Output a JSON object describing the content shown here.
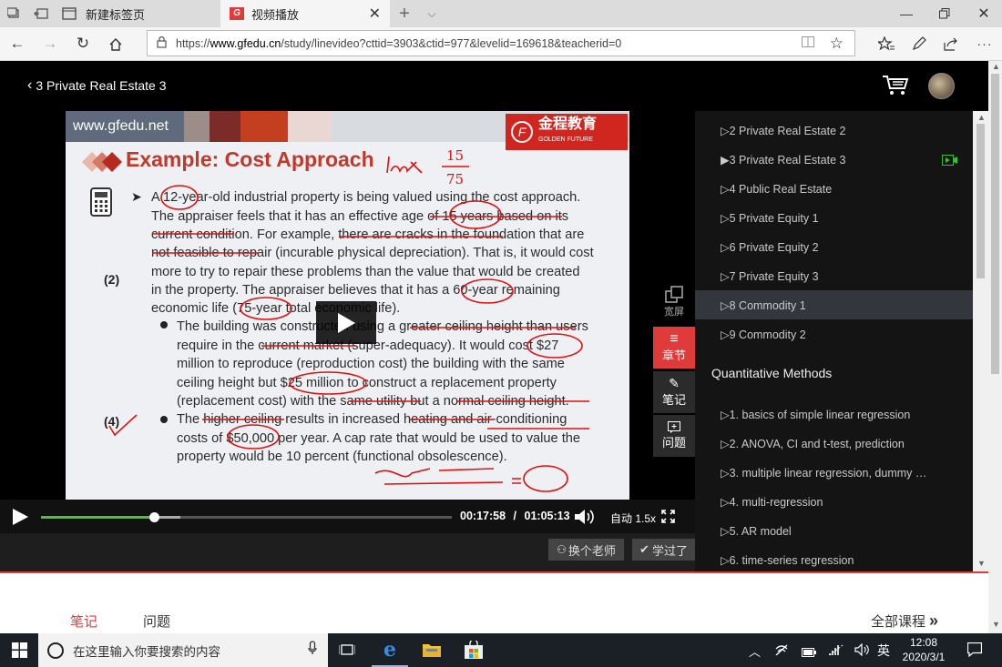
{
  "browser": {
    "tabs": [
      {
        "label": "新建标签页",
        "active": false
      },
      {
        "label": "视频播放",
        "active": true
      }
    ],
    "url_prefix": "https://",
    "url_domain": "www.gfedu.cn",
    "url_path": "/study/linevideo?cttid=3903&ctid=977&levelid=169618&teacherid=0"
  },
  "header": {
    "back_title": "3 Private Real Estate 3"
  },
  "slide": {
    "site": "www.gfedu.net",
    "brand_cn": "金程教育",
    "brand_en": "GOLDEN FUTURE",
    "title": "Example: Cost Approach",
    "marker_2": "(2)",
    "marker_4": "(4)",
    "lines": [
      "A 12-year-old industrial property is being valued using the cost approach.",
      "The appraiser feels that it has an effective age of 15 years based on its",
      "current condition. For example, there are cracks in the foundation that are",
      "not feasible to repair (incurable physical depreciation). That is, it would cost",
      "more to try to repair these problems than the value that would be created",
      "in the property. The appraiser believes that it has a 60-year remaining",
      "economic life (75-year total economic life)."
    ],
    "bullet1": [
      "The building was constructed using a greater ceiling height than users",
      "require in the current market (super-adequacy). It would cost $27",
      "million to reproduce (reproduction cost) the building with the same",
      "ceiling height but $25 million to construct a replacement property",
      "(replacement cost) with the same utility but a normal ceiling height."
    ],
    "bullet2": [
      "The higher ceiling results in increased heating and air-conditioning",
      "costs of $50,000 per year. A cap rate that would be used to value the",
      "property would be 10 percent (functional obsolescence)."
    ]
  },
  "player": {
    "current_time": "00:17:58",
    "separator": "/",
    "total_time": "01:05:13",
    "speed": "自动 1.5x",
    "progress": 0.275,
    "buffered": 0.34,
    "change_teacher": "换个老师",
    "learned": "学过了",
    "widescreen": "宽屏",
    "chapters": "章节",
    "notes": "笔记",
    "questions": "问题"
  },
  "sidebar": {
    "lessons": [
      {
        "label": "▷2 Private Real Estate 2",
        "selected": false,
        "playing": false
      },
      {
        "label": "▶3 Private Real Estate 3",
        "selected": false,
        "playing": true
      },
      {
        "label": "▷4 Public Real Estate",
        "selected": false,
        "playing": false
      },
      {
        "label": "▷5 Private Equity 1",
        "selected": false,
        "playing": false
      },
      {
        "label": "▷6 Private Equity 2",
        "selected": false,
        "playing": false
      },
      {
        "label": "▷7 Private Equity 3",
        "selected": false,
        "playing": false
      },
      {
        "label": "▷8 Commodity 1",
        "selected": true,
        "playing": false
      },
      {
        "label": "▷9 Commodity 2",
        "selected": false,
        "playing": false
      }
    ],
    "section_title": "Quantitative Methods",
    "quant_lessons": [
      "▷1. basics of simple linear regression",
      "▷2. ANOVA, CI and t-test, prediction",
      "▷3. multiple linear regression, dummy …",
      "▷4. multi-regression",
      "▷5. AR model",
      "▷6. time-series regression"
    ]
  },
  "bottom_tabs": {
    "notes": "笔记",
    "questions": "问题",
    "all_courses": "全部课程"
  },
  "taskbar": {
    "search_placeholder": "在这里输入你要搜索的内容",
    "ime": "英",
    "time": "12:08",
    "date": "2020/3/1"
  },
  "colors": {
    "accent_red": "#e03b3b",
    "progress_green": "#4cc23a",
    "slide_title_red": "#c0392b"
  }
}
